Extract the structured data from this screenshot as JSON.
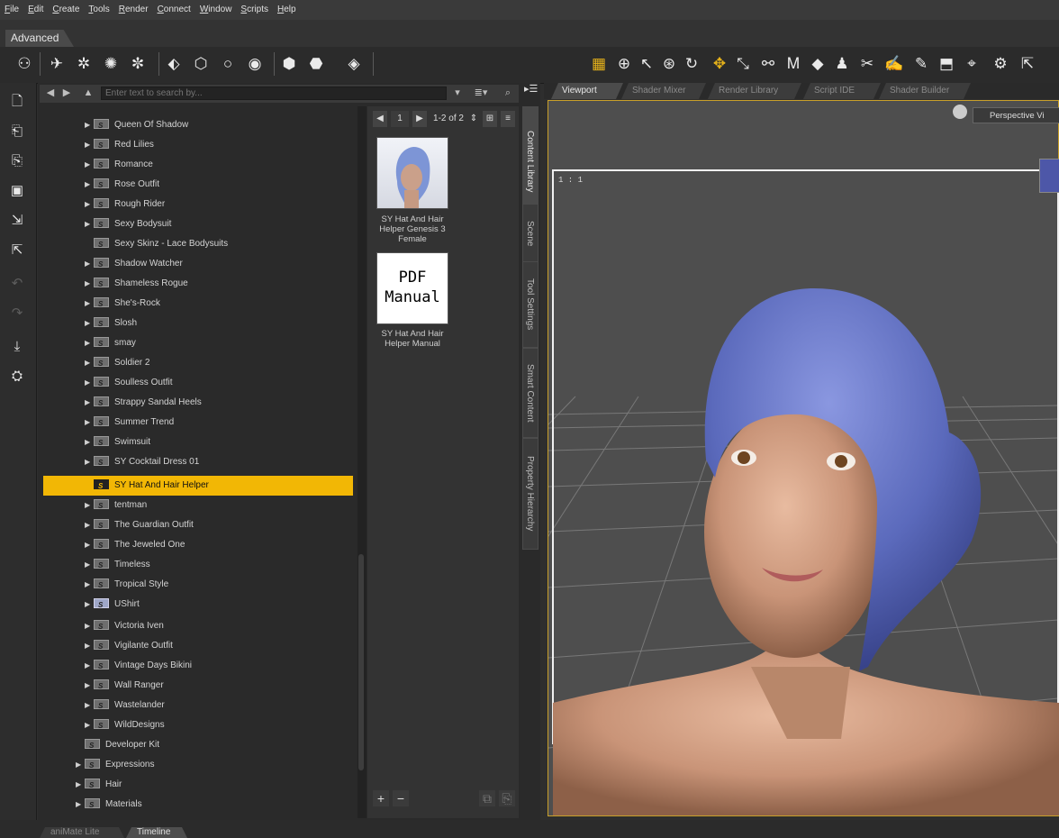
{
  "menu": [
    "File",
    "Edit",
    "Create",
    "Tools",
    "Render",
    "Connect",
    "Window",
    "Scripts",
    "Help"
  ],
  "mode_tab": "Advanced",
  "search": {
    "placeholder": "Enter text to search by..."
  },
  "tree": {
    "items": [
      {
        "label": "Queen Of Shadow",
        "arrow": true
      },
      {
        "label": "Red Lilies",
        "arrow": true
      },
      {
        "label": "Romance",
        "arrow": true
      },
      {
        "label": "Rose Outfit",
        "arrow": true
      },
      {
        "label": "Rough Rider",
        "arrow": true
      },
      {
        "label": "Sexy Bodysuit",
        "arrow": true
      },
      {
        "label": "Sexy Skinz - Lace Bodysuits",
        "arrow": false
      },
      {
        "label": "Shadow Watcher",
        "arrow": true
      },
      {
        "label": "Shameless Rogue",
        "arrow": true
      },
      {
        "label": "She's-Rock",
        "arrow": true
      },
      {
        "label": "Slosh",
        "arrow": true
      },
      {
        "label": "smay",
        "arrow": true
      },
      {
        "label": "Soldier 2",
        "arrow": true
      },
      {
        "label": "Soulless Outfit",
        "arrow": true
      },
      {
        "label": "Strappy Sandal Heels",
        "arrow": true
      },
      {
        "label": "Summer Trend",
        "arrow": true
      },
      {
        "label": "Swimsuit",
        "arrow": true
      },
      {
        "label": "SY Cocktail Dress 01",
        "arrow": true
      },
      {
        "label": "SY Hat And Hair Helper",
        "arrow": false,
        "selected": true
      },
      {
        "label": "tentman",
        "arrow": true
      },
      {
        "label": "The Guardian Outfit",
        "arrow": true
      },
      {
        "label": "The Jeweled One",
        "arrow": true
      },
      {
        "label": "Timeless",
        "arrow": true
      },
      {
        "label": "Tropical Style",
        "arrow": true
      },
      {
        "label": "UShirt",
        "arrow": true,
        "icon": "shirt"
      },
      {
        "label": "Victoria Iven",
        "arrow": true
      },
      {
        "label": "Vigilante Outfit",
        "arrow": true
      },
      {
        "label": "Vintage Days Bikini",
        "arrow": true
      },
      {
        "label": "Wall Ranger",
        "arrow": true
      },
      {
        "label": "Wastelander",
        "arrow": true
      },
      {
        "label": "WildDesigns",
        "arrow": true
      },
      {
        "label": "Developer Kit",
        "arrow": false,
        "level": 0
      },
      {
        "label": "Expressions",
        "arrow": true,
        "level": 0
      },
      {
        "label": "Hair",
        "arrow": true,
        "level": 0
      },
      {
        "label": "Materials",
        "arrow": true,
        "level": 0
      }
    ]
  },
  "assets": {
    "page": "1",
    "range": "1-2 of 2",
    "items": [
      {
        "caption": "SY Hat And Hair Helper Genesis 3 Female"
      },
      {
        "caption": "SY Hat And Hair Helper Manual",
        "thumb_text": "PDF Manual"
      }
    ]
  },
  "side_tabs": [
    "Content Library",
    "Scene",
    "Tool Settings",
    "Smart Content",
    "Property Hierarchy"
  ],
  "viewport": {
    "tabs": [
      "Viewport",
      "Shader Mixer",
      "Render Library",
      "Script IDE",
      "Shader Builder"
    ],
    "camera": "Perspective Vi",
    "ratio": "1 : 1"
  },
  "bottom_tabs": [
    "aniMate Lite",
    "Timeline"
  ],
  "colors": {
    "selection": "#f2b705",
    "hood": "#5a6ab8",
    "frame": "#c9a02a"
  }
}
